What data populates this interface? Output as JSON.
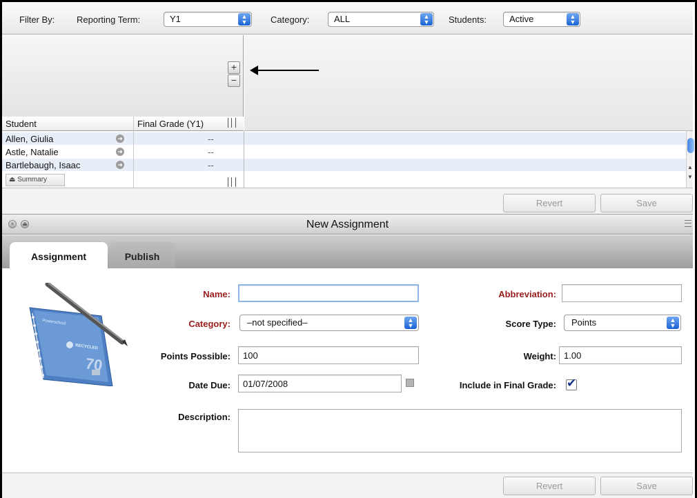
{
  "filter": {
    "filter_by_label": "Filter By:",
    "reporting_term_label": "Reporting Term:",
    "reporting_term_value": "Y1",
    "category_label": "Category:",
    "category_value": "ALL",
    "students_label": "Students:",
    "students_value": "Active"
  },
  "grid": {
    "plus_label": "+",
    "minus_label": "−",
    "col_student": "Student",
    "col_final_grade": "Final Grade (Y1)",
    "rows": [
      {
        "name": "Allen, Giulia",
        "grade": "--"
      },
      {
        "name": "Astle, Natalie",
        "grade": "--"
      },
      {
        "name": "Bartlebaugh, Isaac",
        "grade": "--"
      }
    ],
    "summary_label": "Summary",
    "revert_label": "Revert",
    "save_label": "Save"
  },
  "window": {
    "title": "New Assignment",
    "tabs": [
      {
        "label": "Assignment",
        "active": true
      },
      {
        "label": "Publish",
        "active": false
      }
    ]
  },
  "form": {
    "name_label": "Name:",
    "name_value": "",
    "abbreviation_label": "Abbreviation:",
    "abbreviation_value": "",
    "category_label": "Category:",
    "category_value": "–not specified–",
    "score_type_label": "Score Type:",
    "score_type_value": "Points",
    "points_possible_label": "Points Possible:",
    "points_possible_value": "100",
    "weight_label": "Weight:",
    "weight_value": "1.00",
    "date_due_label": "Date Due:",
    "date_due_value": "01/07/2008",
    "include_final_label": "Include in Final Grade:",
    "include_final_checked": true,
    "description_label": "Description:",
    "description_value": "",
    "revert_label": "Revert",
    "save_label": "Save"
  },
  "notebook": {
    "brand_text": "Powerschool",
    "recycled_text": "RECYCLED",
    "number_text": "70"
  },
  "colors": {
    "required_label": "#9b1c1c",
    "accent_blue": "#1c62d6",
    "row_alt": "#e8eef8"
  }
}
